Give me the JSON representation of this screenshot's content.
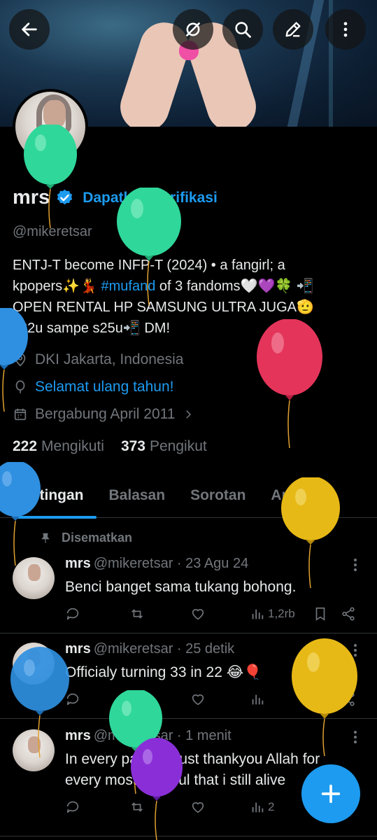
{
  "top_bar": {
    "back_label": "Back",
    "icons": [
      "arrow-left-icon",
      "no-image-icon",
      "search-icon",
      "edit-icon",
      "more-vertical-icon"
    ]
  },
  "profile": {
    "name": "mrs",
    "verify_link": "Dapatkan Verifikasi",
    "handle": "@mikeretsar",
    "bio_line1": "ENTJ-T become INFP-T (2024) • a fangirl; a",
    "bio_line2_a": "kpopers✨💃 ",
    "bio_hashtag": "#mufand",
    "bio_line2_b": " of 3 fandoms🤍💜🍀 📲",
    "bio_line3": "OPEN RENTAL HP SAMSUNG ULTRA JUGA🫡",
    "bio_line4": "s22u sampe s25u📲 DM!",
    "location": "DKI Jakarta, Indonesia",
    "birthday": "Selamat ulang tahun!",
    "joined": "Bergabung April 2011",
    "following_count": "222",
    "following_label": "Mengikuti",
    "followers_count": "373",
    "followers_label": "Pengikut"
  },
  "tabs": [
    {
      "label": "Postingan",
      "active": true
    },
    {
      "label": "Balasan",
      "active": false
    },
    {
      "label": "Sorotan",
      "active": false
    },
    {
      "label": "Artikel",
      "active": false
    }
  ],
  "pinned_label": "Disematkan",
  "posts": [
    {
      "name": "mrs",
      "handle_time": "@mikeretsar · 23 Agu 24",
      "text": "Benci banget sama tukang bohong.",
      "views": "1,2rb"
    },
    {
      "name": "mrs",
      "handle_time": "@mikeretsar · 25 detik",
      "text": "Officialy turning 33 in 22 😂🎈",
      "views": ""
    },
    {
      "name": "mrs",
      "handle_time": "@mikeretsar · 1 menit",
      "text": "In every pains.. i just thankyou Allah for every most grateful that i still alive",
      "views": "2"
    }
  ],
  "colors": {
    "accent": "#1d9bf0",
    "background": "#000000",
    "text": "#e7e9ea",
    "muted": "#71767b",
    "divider": "#2f3336",
    "balloon_green": "#2fd79a",
    "balloon_red": "#e4345a",
    "balloon_blue": "#2f8fe0",
    "balloon_yellow": "#e7b916",
    "balloon_purple": "#8a2fd8"
  }
}
